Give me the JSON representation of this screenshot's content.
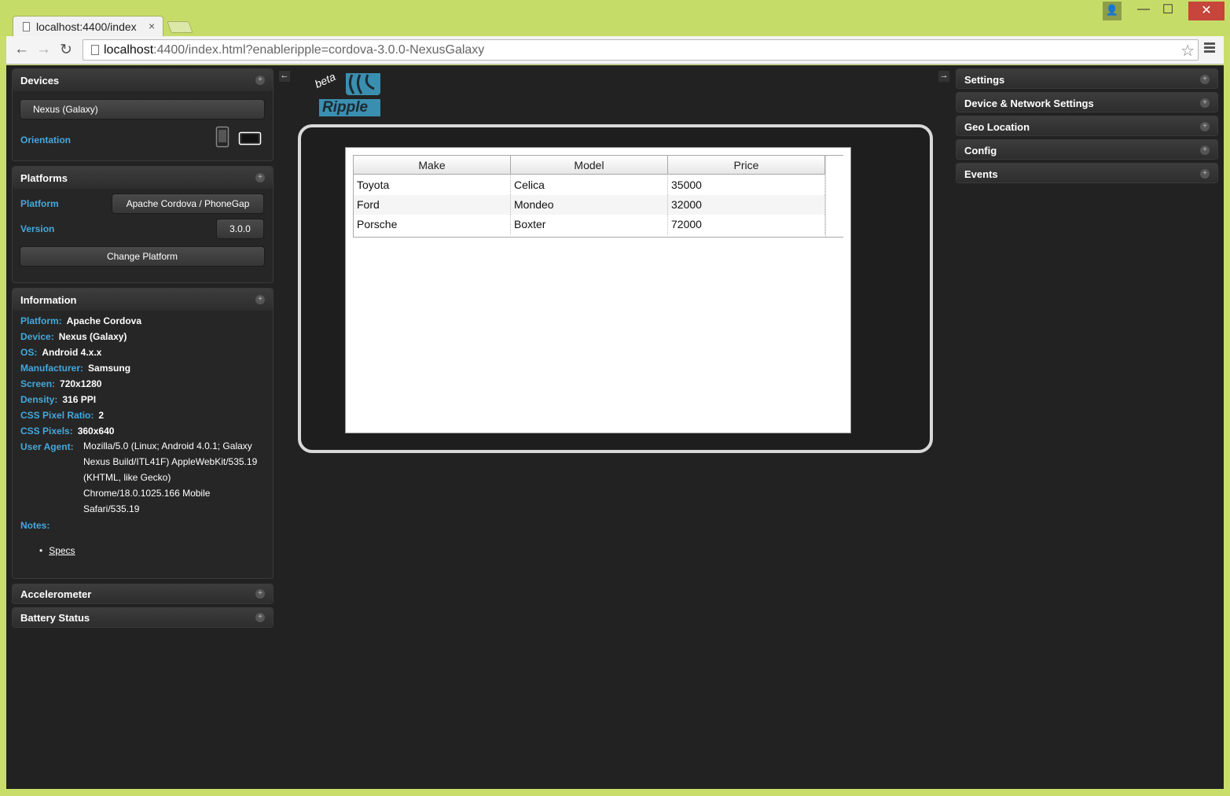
{
  "browser": {
    "tab_title": "localhost:4400/index",
    "tab_close": "×",
    "url_host": "localhost",
    "url_rest": ":4400/index.html?enableripple=cordova-3.0.0-NexusGalaxy",
    "window_buttons": {
      "user": "👤",
      "min": "—",
      "max": "☐",
      "close": "✕"
    },
    "nav": {
      "back": "←",
      "forward": "→",
      "reload": "↻",
      "star": "☆"
    }
  },
  "left": {
    "devices": {
      "title": "Devices",
      "device_select": "Nexus (Galaxy)",
      "orientation_label": "Orientation"
    },
    "platforms": {
      "title": "Platforms",
      "platform_label": "Platform",
      "platform_value": "Apache Cordova / PhoneGap",
      "version_label": "Version",
      "version_value": "3.0.0",
      "change_button": "Change Platform"
    },
    "information": {
      "title": "Information",
      "rows": [
        {
          "k": "Platform:",
          "v": "Apache Cordova"
        },
        {
          "k": "Device:",
          "v": "Nexus (Galaxy)"
        },
        {
          "k": "OS:",
          "v": "Android 4.x.x"
        },
        {
          "k": "Manufacturer:",
          "v": "Samsung"
        },
        {
          "k": "Screen:",
          "v": "720x1280"
        },
        {
          "k": "Density:",
          "v": "316 PPI"
        },
        {
          "k": "CSS Pixel Ratio:",
          "v": "2"
        },
        {
          "k": "CSS Pixels:",
          "v": "360x640"
        }
      ],
      "ua_label": "User Agent:",
      "ua_lines": [
        "Mozilla/5.0 (Linux; Android 4.0.1; Galaxy",
        "Nexus Build/ITL41F) AppleWebKit/535.19",
        "(KHTML, like Gecko)",
        "Chrome/18.0.1025.166 Mobile",
        "Safari/535.19"
      ],
      "notes_label": "Notes:",
      "specs_link": "Specs"
    },
    "accelerometer": {
      "title": "Accelerometer"
    },
    "battery": {
      "title": "Battery Status"
    }
  },
  "right": {
    "panels": [
      "Settings",
      "Device & Network Settings",
      "Geo Location",
      "Config",
      "Events"
    ]
  },
  "logo": {
    "beta": "beta",
    "word": "Ripple"
  },
  "grid": {
    "columns": [
      "Make",
      "Model",
      "Price"
    ],
    "rows": [
      [
        "Toyota",
        "Celica",
        "35000"
      ],
      [
        "Ford",
        "Mondeo",
        "32000"
      ],
      [
        "Porsche",
        "Boxter",
        "72000"
      ]
    ]
  }
}
